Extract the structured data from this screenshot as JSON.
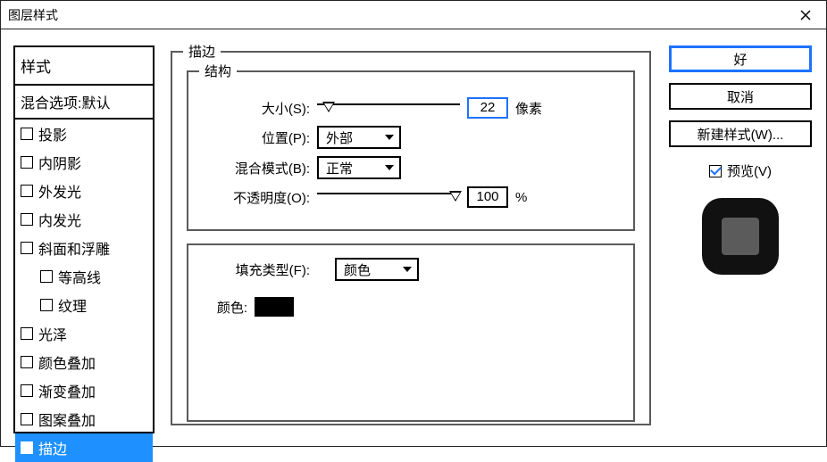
{
  "window": {
    "title": "图层样式"
  },
  "styles": {
    "header": "样式",
    "blend_defaults": "混合选项:默认",
    "items": [
      {
        "label": "投影",
        "checked": false
      },
      {
        "label": "内阴影",
        "checked": false
      },
      {
        "label": "外发光",
        "checked": false
      },
      {
        "label": "内发光",
        "checked": false
      },
      {
        "label": "斜面和浮雕",
        "checked": false
      },
      {
        "label": "等高线",
        "checked": false,
        "indent": true
      },
      {
        "label": "纹理",
        "checked": false,
        "indent": true
      },
      {
        "label": "光泽",
        "checked": false
      },
      {
        "label": "颜色叠加",
        "checked": false
      },
      {
        "label": "渐变叠加",
        "checked": false
      },
      {
        "label": "图案叠加",
        "checked": false
      },
      {
        "label": "描边",
        "checked": true,
        "selected": true
      }
    ]
  },
  "stroke": {
    "group_title": "描边",
    "struct_title": "结构",
    "size_label": "大小(S):",
    "size_value": "22",
    "size_unit": "像素",
    "position_label": "位置(P):",
    "position_value": "外部",
    "blend_label": "混合模式(B):",
    "blend_value": "正常",
    "opacity_label": "不透明度(O):",
    "opacity_value": "100",
    "opacity_unit": "%",
    "fill_type_label": "填充类型(F):",
    "fill_type_value": "颜色",
    "color_label": "颜色:",
    "color_value": "#000000"
  },
  "buttons": {
    "ok": "好",
    "cancel": "取消",
    "new_style": "新建样式(W)...",
    "preview": "预览(V)"
  }
}
